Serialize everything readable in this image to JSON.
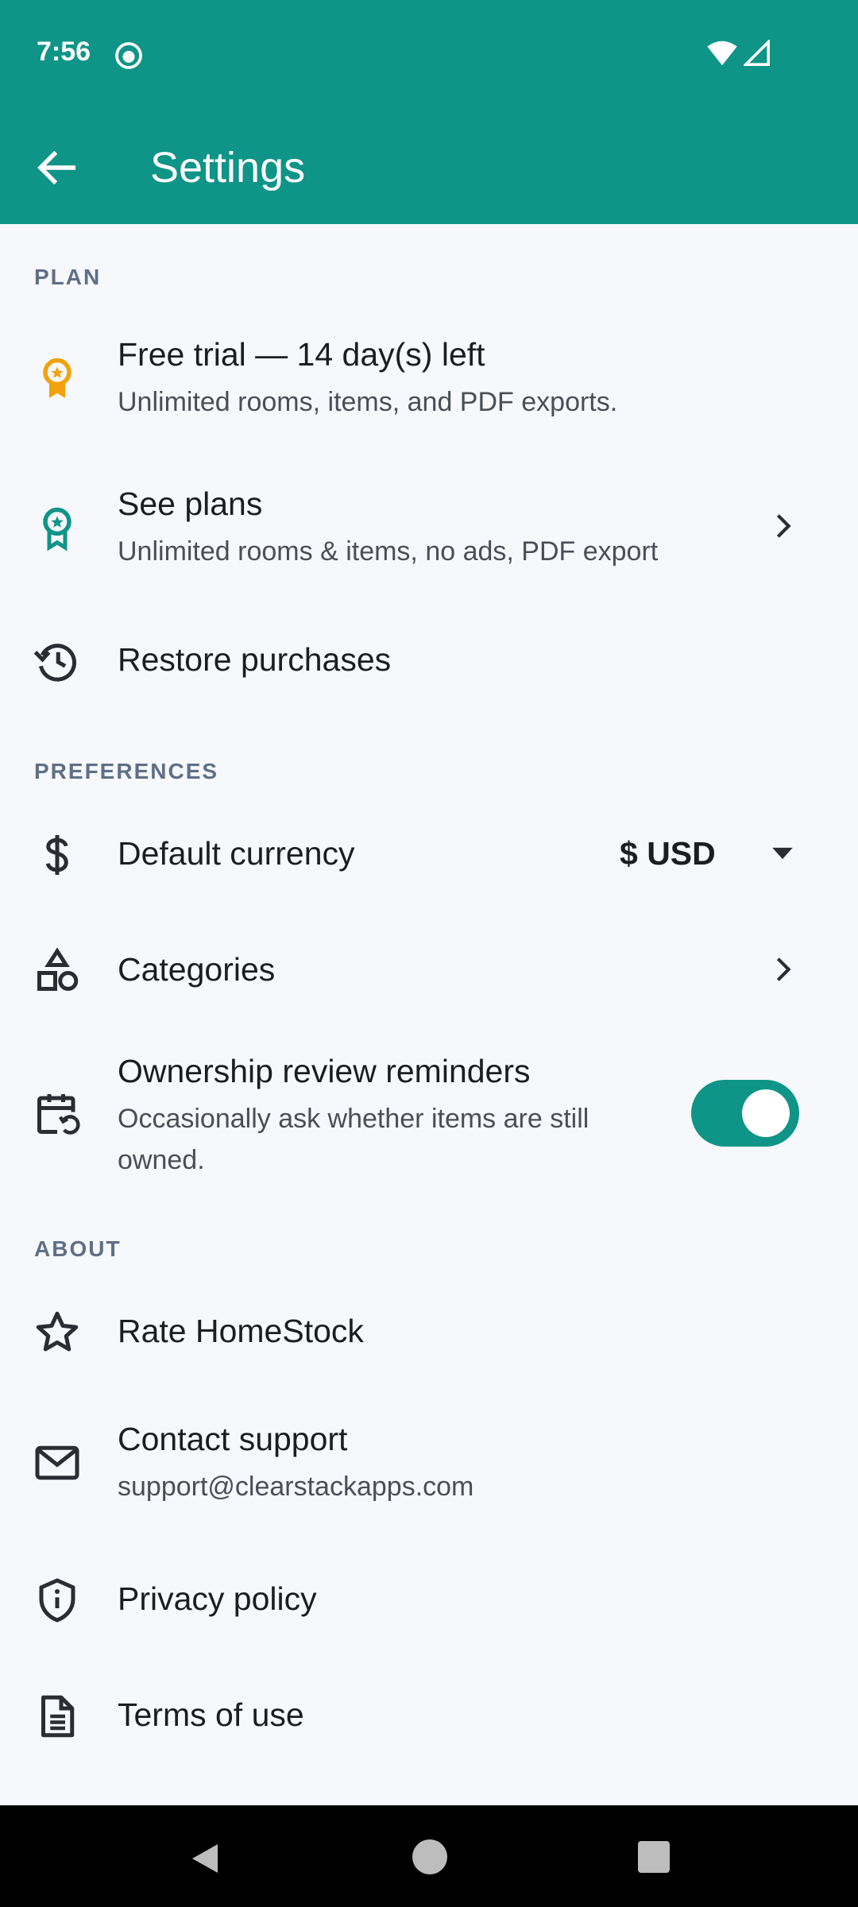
{
  "status_bar": {
    "time": "7:56"
  },
  "app_bar": {
    "title": "Settings"
  },
  "colors": {
    "primary": "#0F9488",
    "trial_accent": "#F2A20C",
    "section_header": "#5F6F86"
  },
  "sections": {
    "plan": "PLAN",
    "preferences": "PREFERENCES",
    "about": "ABOUT"
  },
  "plan": {
    "free_trial": {
      "title": "Free trial — 14 day(s) left",
      "subtitle": "Unlimited rooms, items, and PDF exports.",
      "icon": "award-icon"
    },
    "see_plans": {
      "title": "See plans",
      "subtitle": "Unlimited rooms & items, no ads, PDF export",
      "icon": "award-icon"
    },
    "restore": {
      "title": "Restore purchases",
      "icon": "history-icon"
    }
  },
  "preferences": {
    "currency": {
      "title": "Default currency",
      "value": "$ USD",
      "icon": "dollar-icon"
    },
    "categories": {
      "title": "Categories",
      "icon": "shapes-icon"
    },
    "reminders": {
      "title": "Ownership review reminders",
      "subtitle_line1": "Occasionally ask whether items are still",
      "subtitle_line2": "owned.",
      "enabled": true,
      "icon": "calendar-repeat-icon"
    }
  },
  "about": {
    "rate": {
      "title": "Rate HomeStock",
      "icon": "star-icon"
    },
    "contact": {
      "title": "Contact support",
      "subtitle": "support@clearstackapps.com",
      "icon": "mail-icon"
    },
    "privacy": {
      "title": "Privacy policy",
      "icon": "shield-icon"
    },
    "terms": {
      "title": "Terms of use",
      "icon": "document-icon"
    }
  }
}
